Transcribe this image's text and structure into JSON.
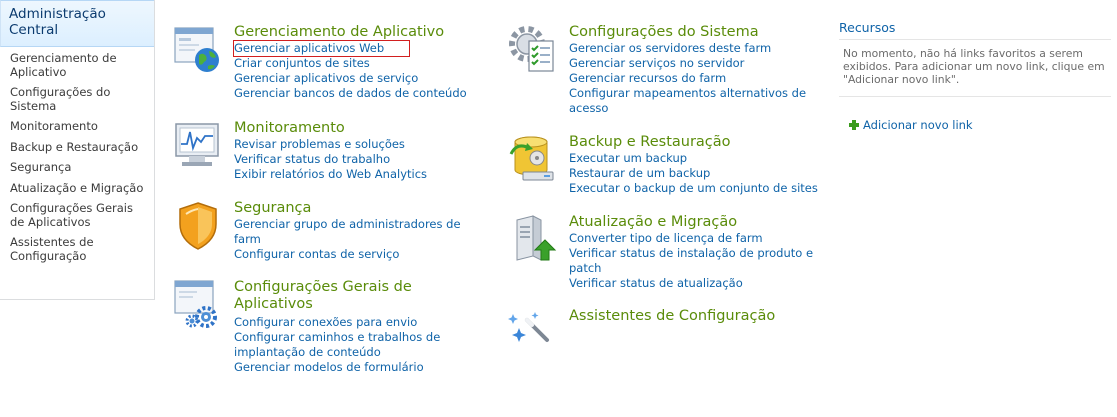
{
  "quicklaunch": {
    "header": "Administração Central",
    "items": [
      {
        "label": "Gerenciamento de Aplicativo"
      },
      {
        "label": "Configurações do Sistema"
      },
      {
        "label": "Monitoramento"
      },
      {
        "label": "Backup e Restauração"
      },
      {
        "label": "Segurança"
      },
      {
        "label": "Atualização e Migração"
      },
      {
        "label": "Configurações Gerais de Aplicativos"
      },
      {
        "label": "Assistentes de Configuração"
      }
    ]
  },
  "sections": {
    "app_mgmt": {
      "title": "Gerenciamento de Aplicativo",
      "links": [
        "Gerenciar aplicativos Web",
        "Criar conjuntos de sites",
        "Gerenciar aplicativos de serviço",
        "Gerenciar bancos de dados de conteúdo"
      ]
    },
    "system": {
      "title": "Configurações do Sistema",
      "links": [
        "Gerenciar os servidores deste farm",
        "Gerenciar serviços no servidor",
        "Gerenciar recursos do farm",
        "Configurar mapeamentos alternativos de acesso"
      ]
    },
    "monitoring": {
      "title": "Monitoramento",
      "links": [
        "Revisar problemas e soluções",
        "Verificar status do trabalho",
        "Exibir relatórios do Web Analytics"
      ]
    },
    "backup": {
      "title": "Backup e Restauração",
      "links": [
        "Executar um backup",
        "Restaurar de um backup",
        "Executar o backup de um conjunto de sites"
      ]
    },
    "security": {
      "title": "Segurança",
      "links": [
        "Gerenciar grupo de administradores de farm",
        "Configurar contas de serviço"
      ]
    },
    "upgrade": {
      "title": "Atualização e Migração",
      "links": [
        "Converter tipo de licença de farm",
        "Verificar status de instalação de produto e patch",
        "Verificar status de atualização"
      ]
    },
    "general": {
      "title": "Configurações Gerais de Aplicativos",
      "links": [
        "Configurar conexões para envio",
        "Configurar caminhos e trabalhos de implantação de conteúdo",
        "Gerenciar modelos de formulário"
      ]
    },
    "wizards": {
      "title": "Assistentes de Configuração",
      "links": []
    }
  },
  "resources": {
    "title": "Recursos",
    "message": "No momento, não há links favoritos a serem exibidos. Para adicionar um novo link, clique em \"Adicionar novo link\".",
    "add_link": "Adicionar novo link"
  },
  "icons": {
    "app_mgmt": "web-application-globe-icon",
    "system": "server-settings-checklist-icon",
    "monitoring": "monitor-chart-icon",
    "backup": "database-restore-icon",
    "security": "shield-icon",
    "upgrade": "server-upgrade-arrow-icon",
    "general": "application-gears-icon",
    "wizards": "magic-wand-icon",
    "add": "plus-icon"
  },
  "colors": {
    "section_title": "#5a8c0a",
    "link": "#0f63a8",
    "highlight_box": "#d21f1f",
    "quicklaunch_header_bg": "#dcefff"
  }
}
